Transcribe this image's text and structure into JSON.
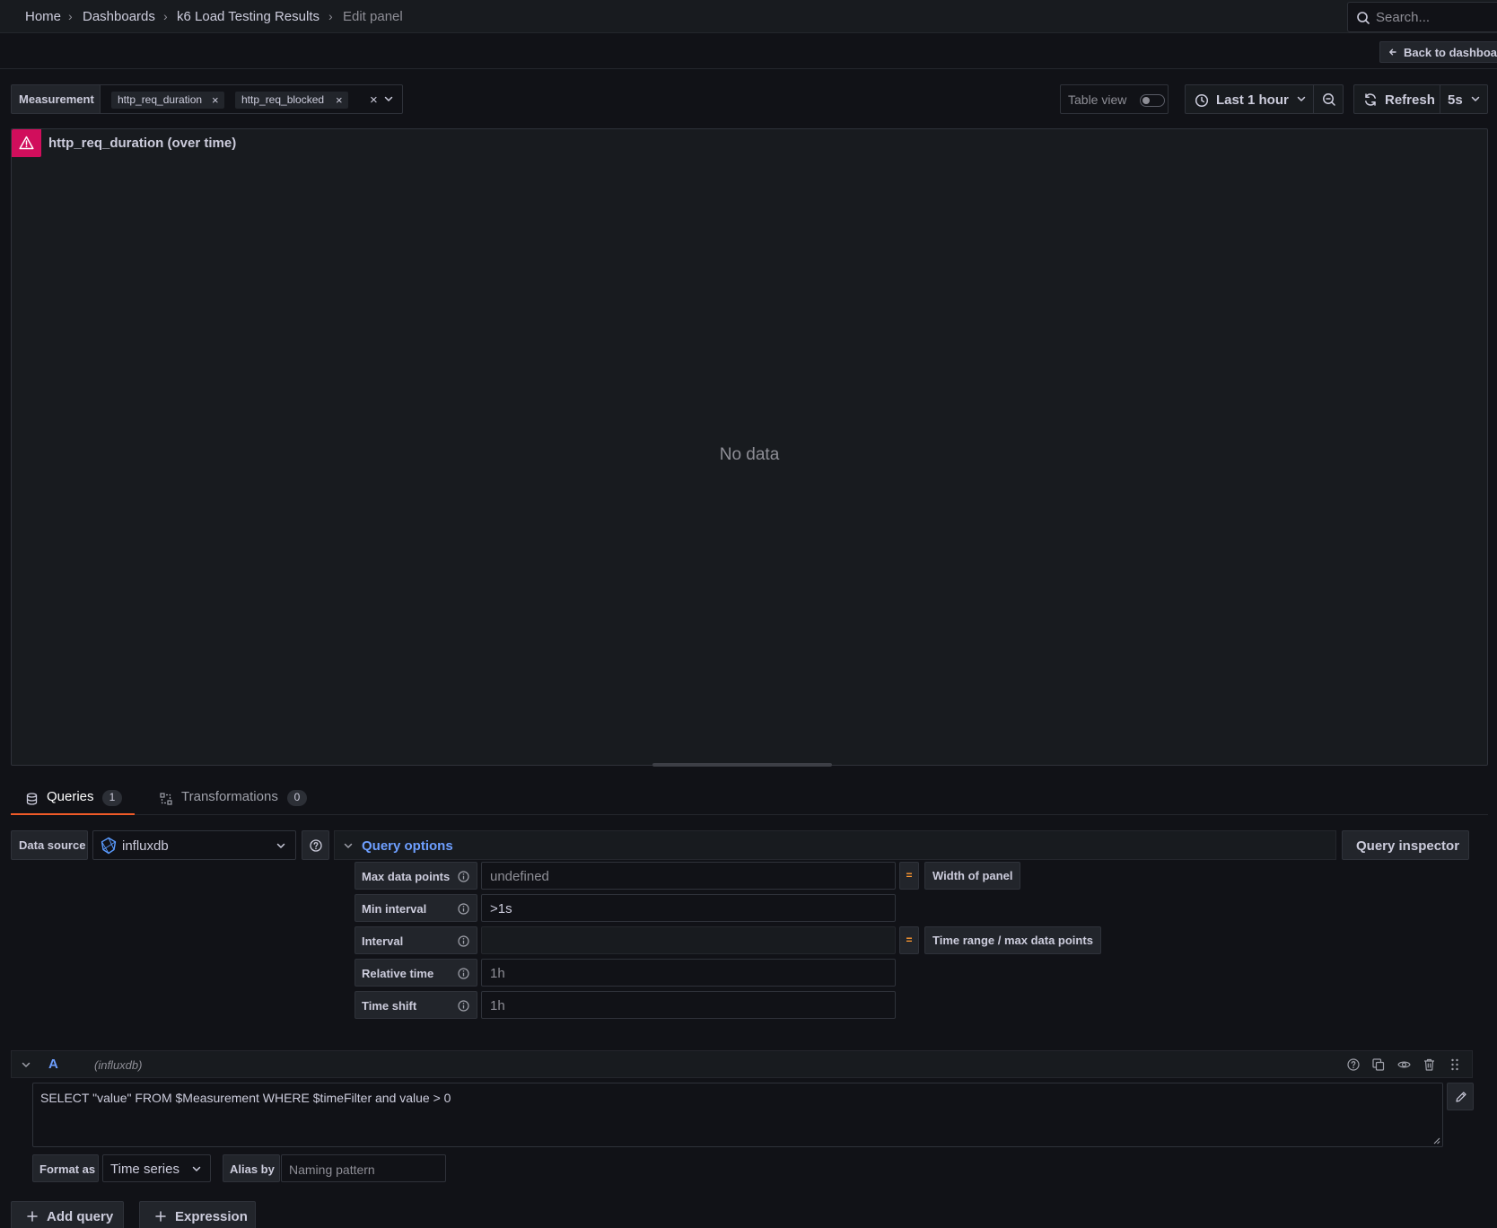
{
  "breadcrumb": {
    "items": [
      "Home",
      "Dashboards",
      "k6 Load Testing Results"
    ],
    "current": "Edit panel",
    "separator": "›"
  },
  "search": {
    "placeholder": "Search..."
  },
  "toolbar": {
    "back_label": "Back to dashboard"
  },
  "variables": {
    "label": "Measurement",
    "selected": [
      "http_req_duration",
      "http_req_blocked"
    ],
    "clear_symbol": "×"
  },
  "controls": {
    "table_view_label": "Table view",
    "table_view_on": false,
    "time_range": "Last 1 hour",
    "refresh_label": "Refresh",
    "refresh_interval": "5s"
  },
  "panel": {
    "title": "http_req_duration (over time)",
    "empty_message": "No data",
    "alert_state": "error"
  },
  "tabs": [
    {
      "label": "Queries",
      "count": "1",
      "active": true
    },
    {
      "label": "Transformations",
      "count": "0",
      "active": false
    }
  ],
  "datasource": {
    "label": "Data source",
    "name": "influxdb"
  },
  "query_options": {
    "title": "Query options",
    "inspector_label": "Query inspector",
    "rows": [
      {
        "label": "Max data points",
        "value": "",
        "placeholder": "undefined",
        "note": "Width of panel"
      },
      {
        "label": "Min interval",
        "value": ">1s",
        "placeholder": "",
        "note": ""
      },
      {
        "label": "Interval",
        "value": "",
        "placeholder": "",
        "note": "Time range / max data points"
      },
      {
        "label": "Relative time",
        "value": "",
        "placeholder": "1h",
        "note": ""
      },
      {
        "label": "Time shift",
        "value": "",
        "placeholder": "1h",
        "note": ""
      }
    ],
    "equals_symbol": "="
  },
  "query": {
    "ref_id": "A",
    "datasource": "(influxdb)",
    "text": "SELECT \"value\" FROM $Measurement WHERE $timeFilter and value > 0",
    "format_label": "Format as",
    "format_value": "Time series",
    "alias_label": "Alias by",
    "alias_placeholder": "Naming pattern"
  },
  "actions": {
    "add_query": "Add query",
    "expression": "Expression"
  },
  "colors": {
    "background": "#111217",
    "panel": "#181b1f",
    "accent_blue": "#6e9fff",
    "alert_red": "#d10e5c",
    "tab_active": "#f05a28",
    "equals_orange": "#ff9830"
  }
}
